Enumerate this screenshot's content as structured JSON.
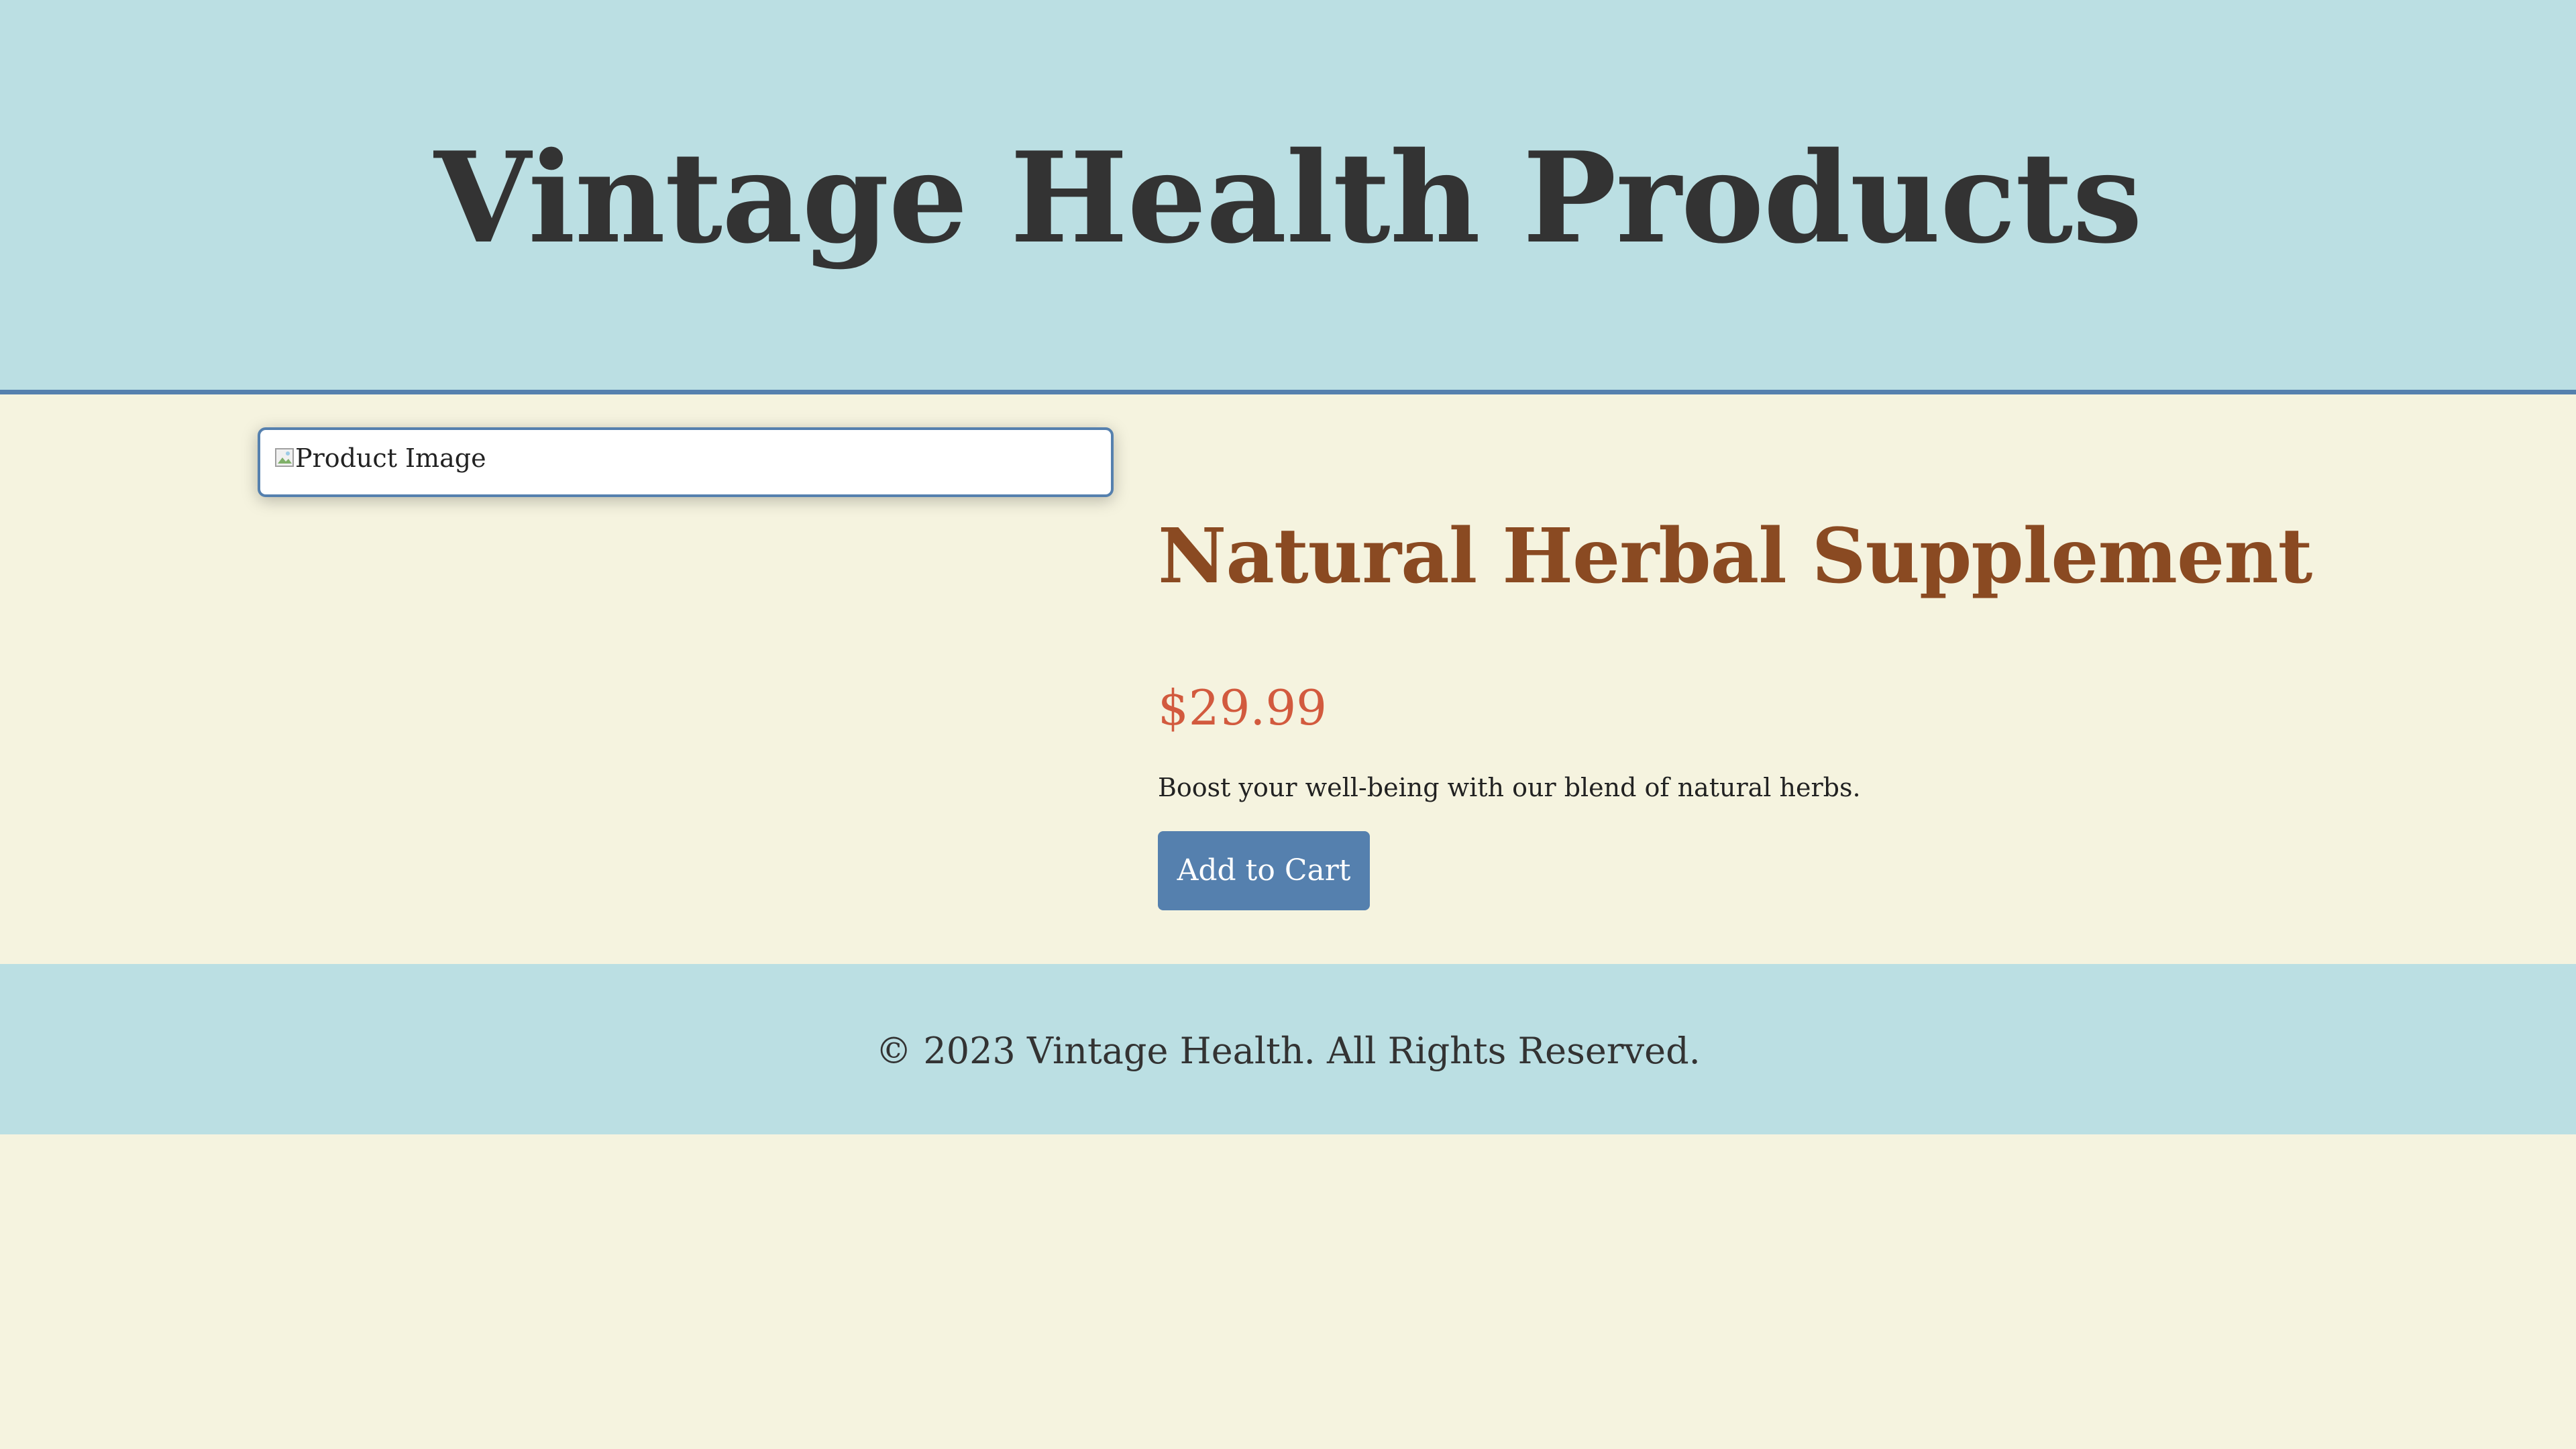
{
  "header": {
    "title": "Vintage Health Products"
  },
  "product": {
    "image_alt": "Product Image",
    "name": "Natural Herbal Supplement",
    "price": "$29.99",
    "description": "Boost your well-being with our blend of natural herbs.",
    "add_to_cart_label": "Add to Cart"
  },
  "footer": {
    "copyright": "© 2023 Vintage Health. All Rights Reserved."
  },
  "colors": {
    "header_bg": "#bbdfe3",
    "page_bg": "#f5f3df",
    "accent": "#5580ae",
    "product_name": "#8a4a22",
    "price": "#d25a3e",
    "title": "#333333"
  },
  "icons": {
    "broken_image": "broken-image-icon"
  }
}
